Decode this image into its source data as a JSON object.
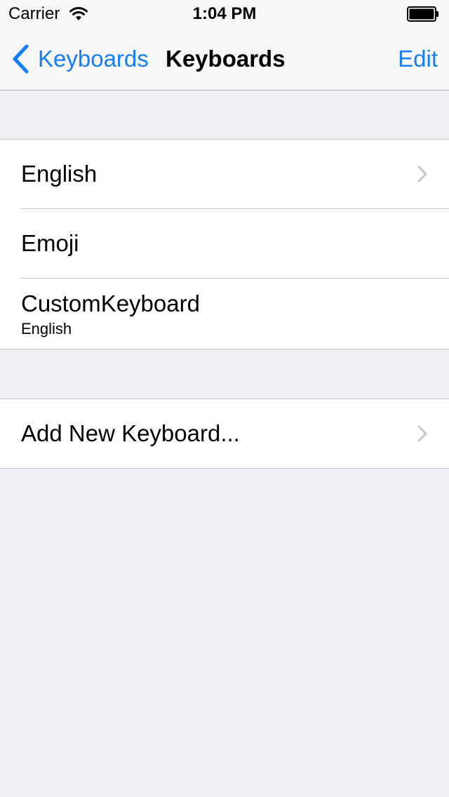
{
  "status_bar": {
    "carrier": "Carrier",
    "time": "1:04 PM",
    "icons": [
      "wifi-icon",
      "battery-icon"
    ]
  },
  "nav": {
    "back_label": "Keyboards",
    "title": "Keyboards",
    "edit_label": "Edit",
    "accent_color": "#147efb"
  },
  "keyboards": [
    {
      "label": "English",
      "detail": "",
      "disclosure": true
    },
    {
      "label": "Emoji",
      "detail": "",
      "disclosure": false
    },
    {
      "label": "CustomKeyboard",
      "detail": "English",
      "disclosure": false
    }
  ],
  "add_keyboard": {
    "label": "Add New Keyboard..."
  },
  "colors": {
    "background": "#efeff4",
    "bar": "#f7f7f7",
    "separator": "#c8c7cc",
    "chevron": "#c7c7cc"
  }
}
